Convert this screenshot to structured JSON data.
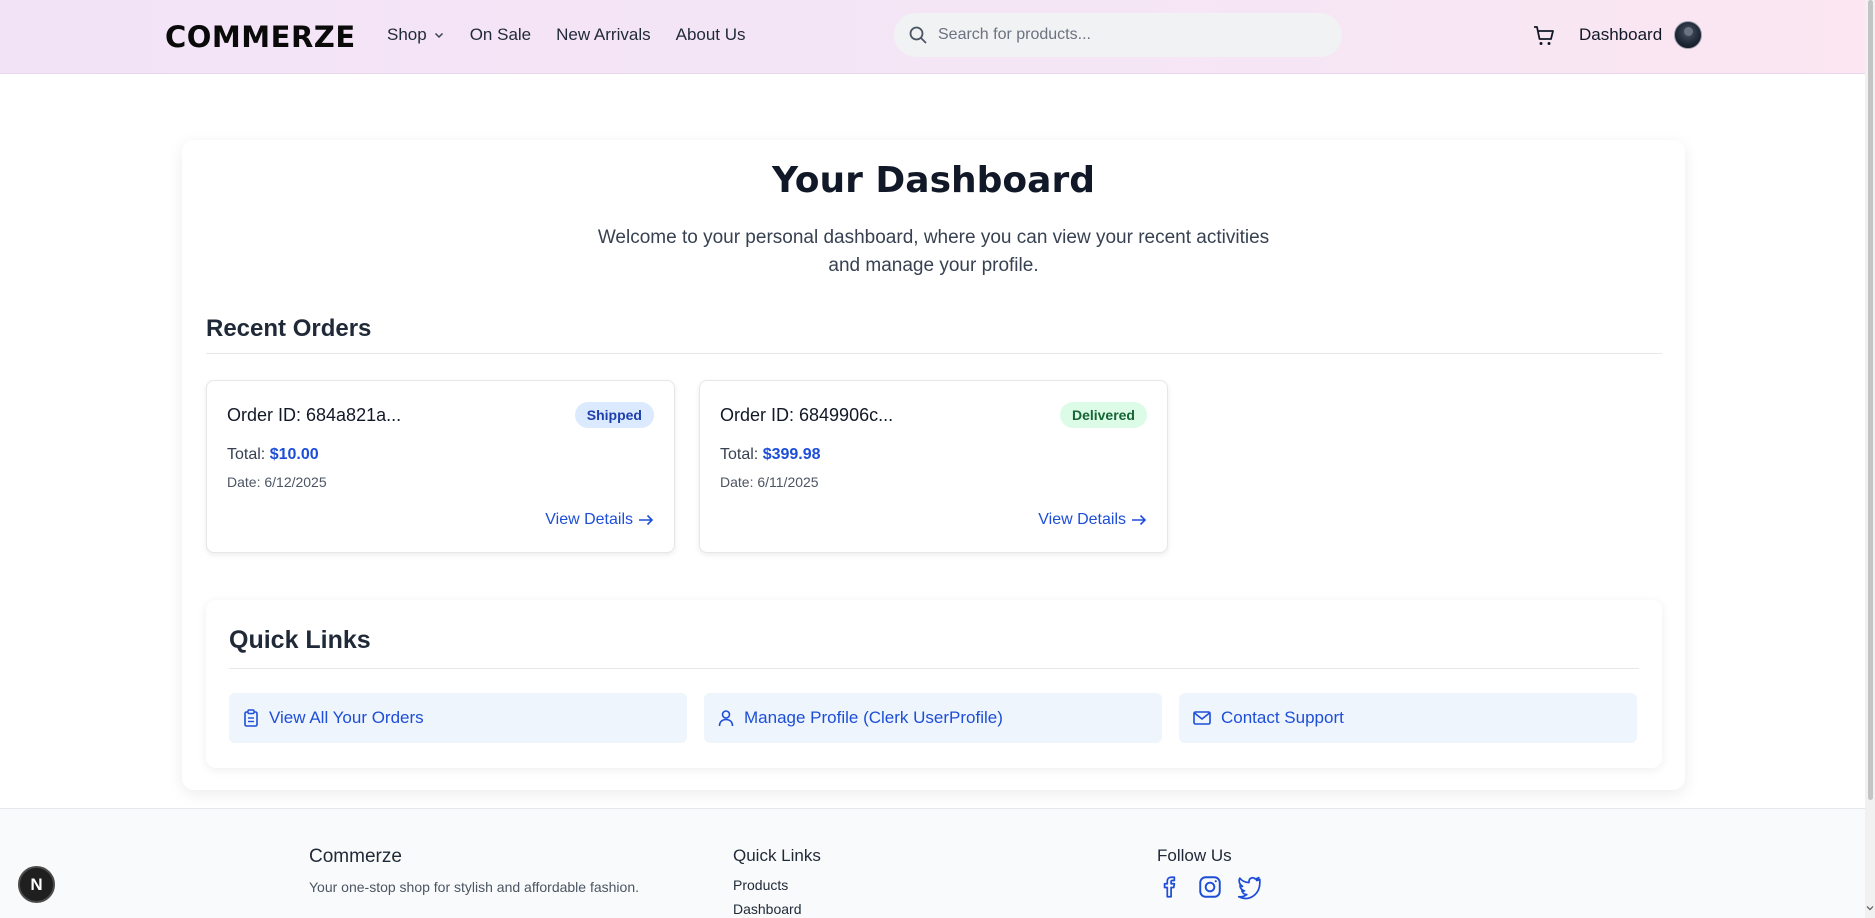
{
  "header": {
    "logo": "COMMERZE",
    "nav": [
      {
        "label": "Shop",
        "has_dropdown": true
      },
      {
        "label": "On Sale"
      },
      {
        "label": "New Arrivals"
      },
      {
        "label": "About Us"
      }
    ],
    "search_placeholder": "Search for products...",
    "dashboard_label": "Dashboard"
  },
  "main": {
    "title": "Your Dashboard",
    "subtitle": "Welcome to your personal dashboard, where you can view your recent activities and manage your profile.",
    "recent_orders_heading": "Recent Orders",
    "orders": [
      {
        "id": "Order ID: 684a821a...",
        "status": "Shipped",
        "total_label": "Total:",
        "total": "$10.00",
        "date": "Date: 6/12/2025",
        "view_label": "View Details"
      },
      {
        "id": "Order ID: 6849906c...",
        "status": "Delivered",
        "total_label": "Total:",
        "total": "$399.98",
        "date": "Date: 6/11/2025",
        "view_label": "View Details"
      }
    ],
    "quick_links_heading": "Quick Links",
    "quick_links": [
      {
        "label": "View All Your Orders",
        "icon": "clipboard-icon"
      },
      {
        "label": "Manage Profile (Clerk UserProfile)",
        "icon": "user-icon"
      },
      {
        "label": "Contact Support",
        "icon": "mail-icon"
      }
    ]
  },
  "footer": {
    "brand": "Commerze",
    "tagline": "Your one-stop shop for stylish and affordable fashion.",
    "quick_links_heading": "Quick Links",
    "links": [
      "Products",
      "Dashboard"
    ],
    "follow_heading": "Follow Us",
    "social": [
      "facebook-icon",
      "instagram-icon",
      "twitter-icon"
    ]
  },
  "dev_badge": "N",
  "colors": {
    "accent_blue": "#1d4ed8",
    "shipped_bg": "#dbeafe",
    "delivered_bg": "#dcfce7",
    "header_bg": "#f3e3f7",
    "quick_link_bg": "#eef5fd"
  }
}
